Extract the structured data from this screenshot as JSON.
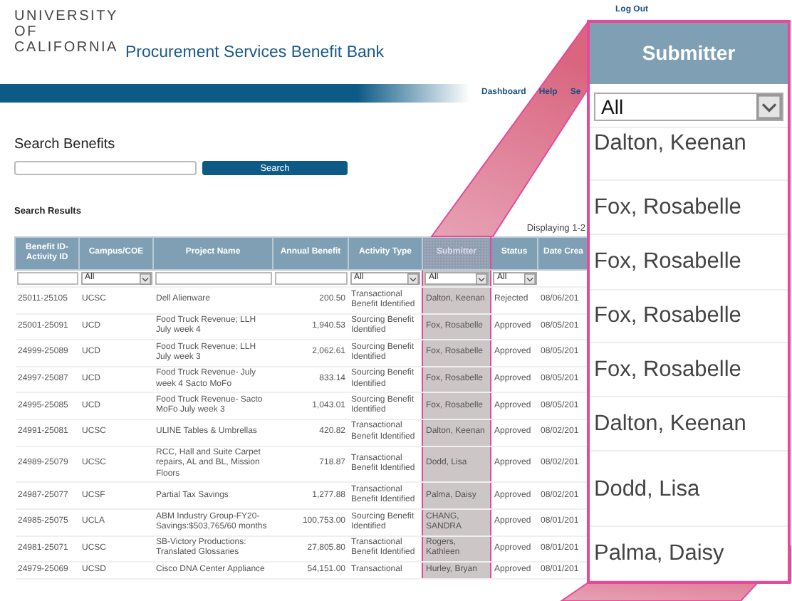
{
  "header": {
    "logo_lines": [
      "UNIVERSITY",
      "OF",
      "CALIFORNIA"
    ],
    "app_title": "Procurement Services Benefit Bank",
    "log_out": "Log Out",
    "nav": [
      "Dashboard",
      "Help",
      "Se"
    ]
  },
  "search": {
    "title": "Search Benefits",
    "button": "Search"
  },
  "results": {
    "title": "Search Results",
    "displaying": "Displaying 1-2",
    "columns": [
      {
        "label": "Benefit ID-Activity ID",
        "filter": {
          "kind": "text"
        },
        "highlighted": false
      },
      {
        "label": "Campus/COE",
        "filter": {
          "kind": "select",
          "value": "All"
        },
        "highlighted": false
      },
      {
        "label": "Project Name",
        "filter": {
          "kind": "text"
        },
        "highlighted": false
      },
      {
        "label": "Annual Benefit",
        "filter": {
          "kind": "text"
        },
        "highlighted": false
      },
      {
        "label": "Activity Type",
        "filter": {
          "kind": "select",
          "value": "All"
        },
        "highlighted": false
      },
      {
        "label": "Submitter",
        "filter": {
          "kind": "select",
          "value": "All"
        },
        "highlighted": true
      },
      {
        "label": "Status",
        "filter": {
          "kind": "select",
          "value": "All"
        },
        "highlighted": false
      },
      {
        "label": "Date Crea",
        "filter": {
          "kind": "none"
        },
        "highlighted": false
      }
    ],
    "rows": [
      [
        "25011-25105",
        "UCSC",
        "Dell Alienware",
        "200.50",
        "Transactional Benefit Identified",
        "Dalton, Keenan",
        "Rejected",
        "08/06/201"
      ],
      [
        "25001-25091",
        "UCD",
        "Food Truck Revenue; LLH July week 4",
        "1,940.53",
        "Sourcing Benefit Identified",
        "Fox, Rosabelle",
        "Approved",
        "08/05/201"
      ],
      [
        "24999-25089",
        "UCD",
        "Food Truck Revenue; LLH July week 3",
        "2,062.61",
        "Sourcing Benefit Identified",
        "Fox, Rosabelle",
        "Approved",
        "08/05/201"
      ],
      [
        "24997-25087",
        "UCD",
        "Food Truck Revenue- July week 4 Sacto MoFo",
        "833.14",
        "Sourcing Benefit Identified",
        "Fox, Rosabelle",
        "Approved",
        "08/05/201"
      ],
      [
        "24995-25085",
        "UCD",
        "Food Truck Revenue- Sacto MoFo July week 3",
        "1,043.01",
        "Sourcing Benefit Identified",
        "Fox, Rosabelle",
        "Approved",
        "08/05/201"
      ],
      [
        "24991-25081",
        "UCSC",
        "ULINE Tables & Umbrellas",
        "420.82",
        "Transactional Benefit Identified",
        "Dalton, Keenan",
        "Approved",
        "08/02/201"
      ],
      [
        "24989-25079",
        "UCSC",
        "RCC, Hall and Suite Carpet repairs, AL and BL, Mission Floors",
        "718.87",
        "Transactional Benefit Identified",
        "Dodd, Lisa",
        "Approved",
        "08/02/201"
      ],
      [
        "24987-25077",
        "UCSF",
        "Partial Tax Savings",
        "1,277.88",
        "Transactional Benefit Identified",
        "Palma, Daisy",
        "Approved",
        "08/02/201"
      ],
      [
        "24985-25075",
        "UCLA",
        "ABM Industry Group-FY20-Savings:$503,765/60 months",
        "100,753.00",
        "Sourcing Benefit Identified",
        "CHANG, SANDRA",
        "Approved",
        "08/01/201"
      ],
      [
        "24981-25071",
        "UCSC",
        "SB-Victory Productions: Translated Glossaries",
        "27,805.80",
        "Transactional Benefit Identified",
        "Rogers, Kathleen",
        "Approved",
        "08/01/201"
      ],
      [
        "24979-25069",
        "UCSD",
        "Cisco DNA Center Appliance",
        "54,151.00",
        "Transactional",
        "Hurley, Bryan",
        "Approved",
        "08/01/201"
      ]
    ]
  },
  "magnifier": {
    "title": "Submitter",
    "filter": {
      "kind": "select",
      "value": "All"
    },
    "entries": [
      "Dalton, Keenan",
      "Fox, Rosabelle",
      "Fox, Rosabelle",
      "Fox, Rosabelle",
      "Fox, Rosabelle",
      "Dalton, Keenan",
      "Dodd, Lisa",
      "Palma, Daisy"
    ]
  }
}
